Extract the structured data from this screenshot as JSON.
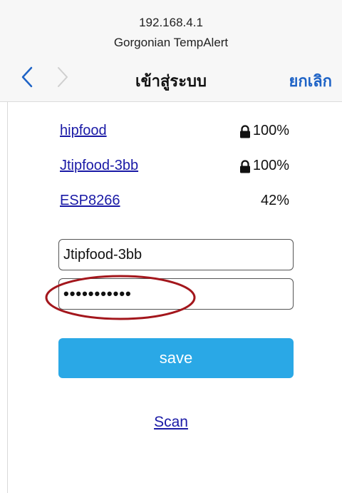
{
  "browser": {
    "host": "192.168.4.1",
    "page_title": "Gorgonian TempAlert"
  },
  "nav": {
    "back_icon": "chevron-left-icon",
    "forward_icon": "chevron-right-icon",
    "title": "เข้าสู่ระบบ",
    "cancel_label": "ยกเลิก",
    "accent_color": "#1e63c6"
  },
  "networks": [
    {
      "ssid": "hipfood",
      "secured": true,
      "signal": "100%"
    },
    {
      "ssid": "Jtipfood-3bb",
      "secured": true,
      "signal": "100%"
    },
    {
      "ssid": "ESP8266",
      "secured": false,
      "signal": "42%"
    }
  ],
  "form": {
    "ssid_value": "Jtipfood-3bb",
    "password_masked": "•••••••••••",
    "save_label": "save",
    "save_color": "#2aa8e6",
    "highlight_color": "#a3161c"
  },
  "scan_label": "Scan"
}
